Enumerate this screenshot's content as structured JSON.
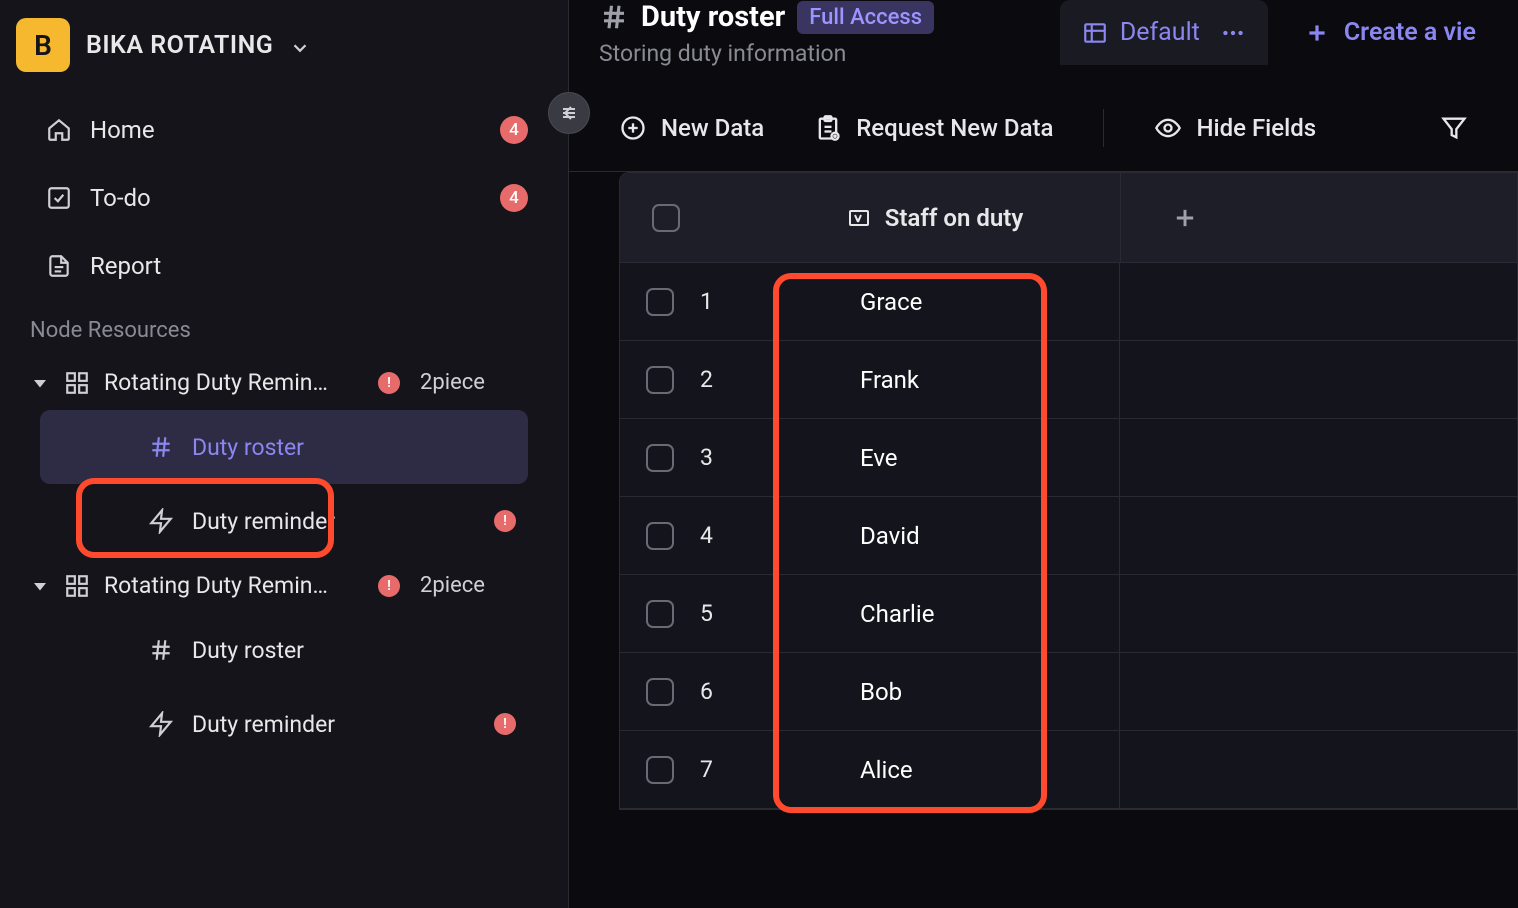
{
  "workspace": {
    "logo_letter": "B",
    "name": "BIKA ROTATING"
  },
  "nav": {
    "home": {
      "label": "Home",
      "badge": "4"
    },
    "todo": {
      "label": "To-do",
      "badge": "4"
    },
    "report": {
      "label": "Report"
    }
  },
  "section_label": "Node Resources",
  "tree": [
    {
      "label": "Rotating Duty Remin…",
      "alert": "!",
      "count": "2piece",
      "children": [
        {
          "label": "Duty roster",
          "type": "hash",
          "active": true
        },
        {
          "label": "Duty reminder",
          "type": "bolt",
          "alert": "!"
        }
      ]
    },
    {
      "label": "Rotating Duty Remin…",
      "alert": "!",
      "count": "2piece",
      "children": [
        {
          "label": "Duty roster",
          "type": "hash"
        },
        {
          "label": "Duty reminder",
          "type": "bolt",
          "alert": "!"
        }
      ]
    }
  ],
  "page": {
    "title": "Duty roster",
    "access": "Full Access",
    "subtitle": "Storing duty information"
  },
  "views": {
    "default": "Default",
    "create": "Create a vie"
  },
  "toolbar": {
    "new_data": "New Data",
    "request_new_data": "Request New Data",
    "hide_fields": "Hide Fields"
  },
  "table": {
    "column": "Staff on duty",
    "rows": [
      {
        "n": "1",
        "name": "Grace"
      },
      {
        "n": "2",
        "name": "Frank"
      },
      {
        "n": "3",
        "name": "Eve"
      },
      {
        "n": "4",
        "name": "David"
      },
      {
        "n": "5",
        "name": "Charlie"
      },
      {
        "n": "6",
        "name": "Bob"
      },
      {
        "n": "7",
        "name": "Alice"
      }
    ]
  }
}
